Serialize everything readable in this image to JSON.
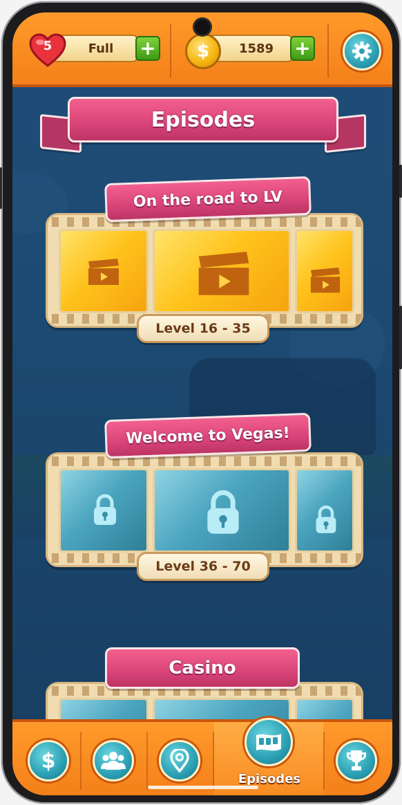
{
  "header": {
    "lives_count": "5",
    "lives_status": "Full",
    "coins": "1589",
    "plus_label": "+"
  },
  "page_title": "Episodes",
  "episodes": [
    {
      "title": "On the road to LV",
      "levels": "Level 16 - 35",
      "state": "unlocked"
    },
    {
      "title": "Welcome to Vegas!",
      "levels": "Level 36 - 70",
      "state": "locked"
    },
    {
      "title": "Casino",
      "state": "locked"
    }
  ],
  "bottom_nav": {
    "items": [
      {
        "icon": "dollar-icon",
        "glyph": "$"
      },
      {
        "icon": "friends-icon"
      },
      {
        "icon": "map-pin-icon"
      },
      {
        "icon": "episodes-film-icon",
        "label": "Episodes",
        "active": true
      },
      {
        "icon": "trophy-icon"
      }
    ]
  },
  "colors": {
    "orange": "#f4801a",
    "ribbon_pink": "#d94478",
    "teal_button": "#2a9fb3",
    "plus_green": "#3e9a14",
    "bg_blue": "#1c4a72"
  }
}
